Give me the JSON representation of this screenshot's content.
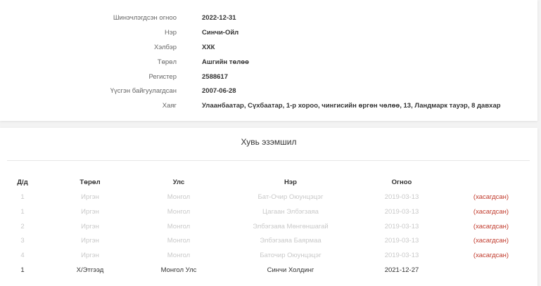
{
  "company_info": {
    "rows": [
      {
        "label": "Шинэчлэгдсэн огноо",
        "value": "2022-12-31"
      },
      {
        "label": "Нэр",
        "value": "Синчи-Ойл"
      },
      {
        "label": "Хэлбэр",
        "value": "ХХК"
      },
      {
        "label": "Төрөл",
        "value": "Ашгийн төлөө"
      },
      {
        "label": "Регистер",
        "value": "2588617"
      },
      {
        "label": "Үүсгэн байгуулагдсан",
        "value": "2007-06-28"
      },
      {
        "label": "Хаяг",
        "value": "Улаанбаатар, Сүхбаатар, 1-р хороо, чингисийн өргөн чөлөө, 13, Ландмарк тауэр, 8 давхар"
      }
    ]
  },
  "ownership": {
    "title": "Хувь эзэмшил",
    "headers": {
      "index": "Д/д",
      "type": "Төрөл",
      "country": "Улс",
      "name": "Нэр",
      "date": "Огноо"
    },
    "rows": [
      {
        "index": "1",
        "type": "Иргэн",
        "country": "Монгол",
        "name": "Бат-Очир Оюунцэцэг",
        "date": "2019-03-13",
        "status": "(хасагдсан)",
        "removed": true
      },
      {
        "index": "1",
        "type": "Иргэн",
        "country": "Монгол",
        "name": "Цагаан Элбэгзаяа",
        "date": "2019-03-13",
        "status": "(хасагдсан)",
        "removed": true
      },
      {
        "index": "2",
        "type": "Иргэн",
        "country": "Монгол",
        "name": "Элбэгзаяа Мөнгөншагай",
        "date": "2019-03-13",
        "status": "(хасагдсан)",
        "removed": true
      },
      {
        "index": "3",
        "type": "Иргэн",
        "country": "Монгол",
        "name": "Элбэгзаяа Баярмаа",
        "date": "2019-03-13",
        "status": "(хасагдсан)",
        "removed": true
      },
      {
        "index": "4",
        "type": "Иргэн",
        "country": "Монгол",
        "name": "Баточир Оюунцэцэг",
        "date": "2019-03-13",
        "status": "(хасагдсан)",
        "removed": true
      },
      {
        "index": "1",
        "type": "Х/Этгээд",
        "country": "Монгол Улс",
        "name": "Синчи Холдинг",
        "date": "2021-12-27",
        "status": "",
        "removed": false
      }
    ]
  },
  "colors": {
    "removed_status": "#c0392b",
    "removed_text": "#c9c9c9"
  }
}
